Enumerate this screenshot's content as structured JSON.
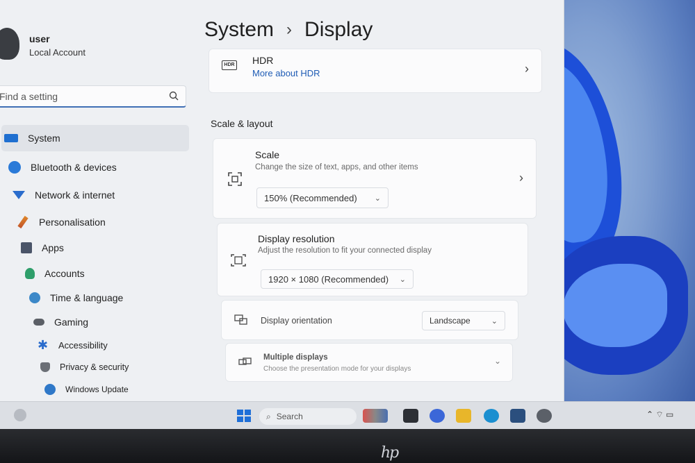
{
  "profile": {
    "name": "user",
    "account_type": "Local Account"
  },
  "search": {
    "placeholder": "Find a setting"
  },
  "nav": {
    "items": [
      {
        "label": "System",
        "icon": "monitor-icon",
        "active": true
      },
      {
        "label": "Bluetooth & devices",
        "icon": "bluetooth-icon"
      },
      {
        "label": "Network & internet",
        "icon": "wifi-icon"
      },
      {
        "label": "Personalisation",
        "icon": "brush-icon"
      },
      {
        "label": "Apps",
        "icon": "apps-icon"
      },
      {
        "label": "Accounts",
        "icon": "person-icon"
      },
      {
        "label": "Time & language",
        "icon": "globe-icon"
      },
      {
        "label": "Gaming",
        "icon": "gamepad-icon"
      },
      {
        "label": "Accessibility",
        "icon": "accessibility-icon"
      },
      {
        "label": "Privacy & security",
        "icon": "shield-icon"
      },
      {
        "label": "Windows Update",
        "icon": "update-icon"
      }
    ]
  },
  "header": {
    "parent": "System",
    "current": "Display"
  },
  "hdr": {
    "icon_text": "HDR",
    "title": "HDR",
    "link": "More about HDR"
  },
  "section": {
    "title": "Scale & layout"
  },
  "scale": {
    "title": "Scale",
    "subtitle": "Change the size of text, apps, and other items",
    "value": "150% (Recommended)"
  },
  "resolution": {
    "title": "Display resolution",
    "subtitle": "Adjust the resolution to fit your connected display",
    "value": "1920 × 1080 (Recommended)"
  },
  "orientation": {
    "title": "Display orientation",
    "value": "Landscape"
  },
  "multiple": {
    "title": "Multiple displays",
    "subtitle": "Choose the presentation mode for your displays"
  },
  "taskbar": {
    "search_label": "Search"
  },
  "brand": {
    "logo": "hp"
  },
  "colors": {
    "accent": "#1f5cb5",
    "window_bg": "#eef0f3",
    "card_bg": "#fbfbfc"
  }
}
